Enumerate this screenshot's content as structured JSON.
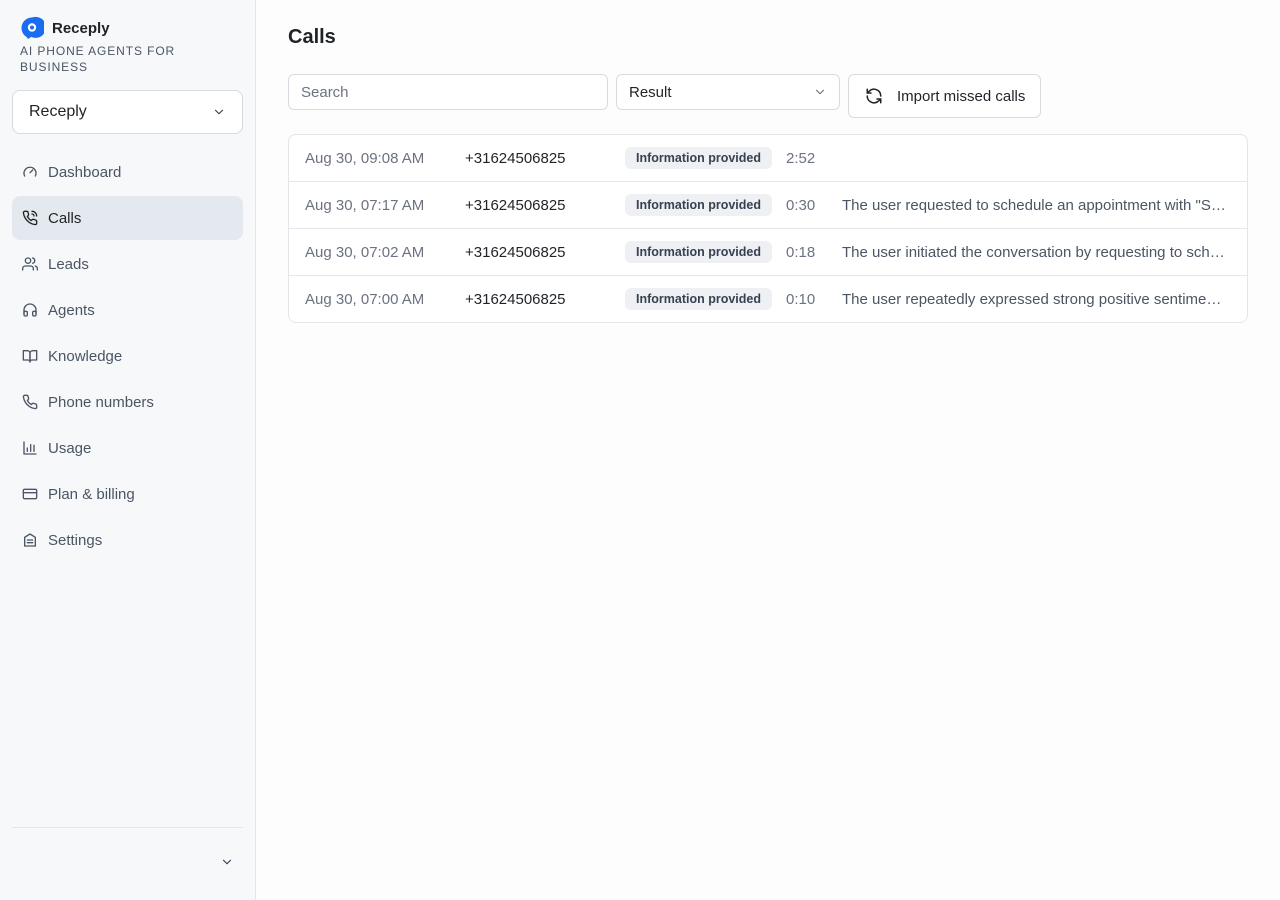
{
  "brand": {
    "name": "Receply",
    "tagline": "AI PHONE AGENTS FOR BUSINESS",
    "accent_color": "#1a6cf0"
  },
  "org_select": {
    "value": "Receply"
  },
  "sidebar": {
    "items": [
      {
        "label": "Dashboard",
        "icon": "gauge-icon",
        "active": false
      },
      {
        "label": "Calls",
        "icon": "phone-call-icon",
        "active": true
      },
      {
        "label": "Leads",
        "icon": "users-icon",
        "active": false
      },
      {
        "label": "Agents",
        "icon": "agent-icon",
        "active": false
      },
      {
        "label": "Knowledge",
        "icon": "book-open-icon",
        "active": false
      },
      {
        "label": "Phone numbers",
        "icon": "phone-icon",
        "active": false
      },
      {
        "label": "Usage",
        "icon": "bar-chart-icon",
        "active": false
      },
      {
        "label": "Plan & billing",
        "icon": "credit-card-icon",
        "active": false
      },
      {
        "label": "Settings",
        "icon": "settings-icon",
        "active": false
      }
    ]
  },
  "main": {
    "title": "Calls",
    "search_placeholder": "Search",
    "result_filter": "Result",
    "import_label": "Import missed calls"
  },
  "calls": [
    {
      "date": "Aug 30, 09:08 AM",
      "phone": "+31624506825",
      "result": "Information provided",
      "duration": "2:52",
      "summary": ""
    },
    {
      "date": "Aug 30, 07:17 AM",
      "phone": "+31624506825",
      "result": "Information provided",
      "duration": "0:30",
      "summary": "The user requested to schedule an appointment with \"S…"
    },
    {
      "date": "Aug 30, 07:02 AM",
      "phone": "+31624506825",
      "result": "Information provided",
      "duration": "0:18",
      "summary": "The user initiated the conversation by requesting to sch…"
    },
    {
      "date": "Aug 30, 07:00 AM",
      "phone": "+31624506825",
      "result": "Information provided",
      "duration": "0:10",
      "summary": "The user repeatedly expressed strong positive sentime…"
    }
  ]
}
